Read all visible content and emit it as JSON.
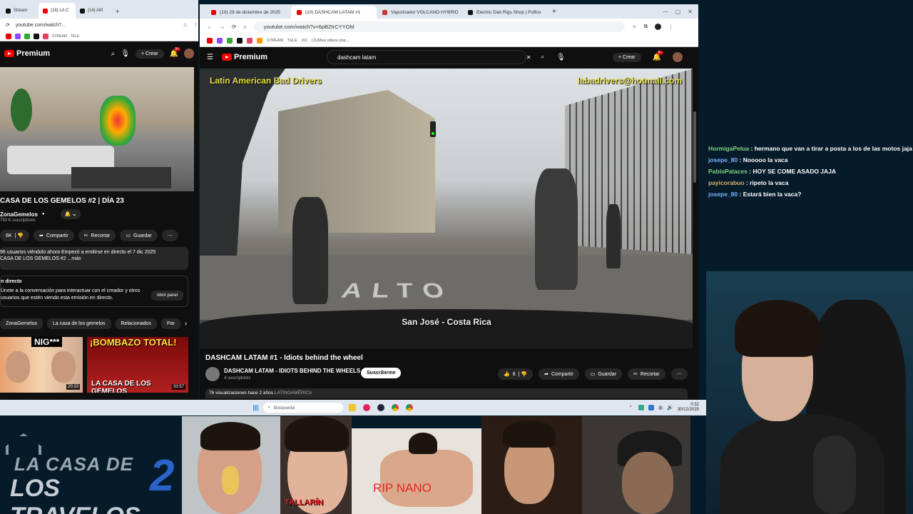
{
  "left_browser": {
    "tabs": [
      "Stream",
      "(18) LA C",
      "(14) AM"
    ],
    "url": "youtube.com/watch?...",
    "bookmarks": [
      "STREAM",
      "TELE"
    ],
    "yt_brand": "Premium",
    "create_label": "Crear",
    "notif_count": "9+",
    "video_title": "CASA DE LOS GEMELOS #2 | DÍA 23",
    "channel": "ZonaGemelos",
    "subscribers": "750 K suscriptores",
    "like_count": "6K",
    "actions": [
      "Compartir",
      "Recortar",
      "Guardar"
    ],
    "desc_line1": "96 usuarios viéndolo ahora  Empezó a emitirse en directo el 7 dic 2025",
    "desc_line2": "CASA DE LOS GEMELOS #2 ...más",
    "live_heading": "n directo",
    "live_text": "Únete a la conversación para interactuar con el creador y otros usuarios que estén viendo esta emisión en directo.",
    "open_panel": "Abrir panel",
    "chips": [
      "ZonaGemelos",
      "La casa de los gemelos",
      "Relacionados",
      "Par"
    ],
    "thumb1_text": "NIG***",
    "thumb1_time": "20:10",
    "thumb2_text": "¡BOMBAZO TOTAL!",
    "thumb2_sub": "LA CASA DE LOS GEMELOS",
    "thumb2_time": "33:57"
  },
  "right_browser": {
    "tabs": [
      "(10) 29 de diciembre de 2025",
      "(10) DASHCAM LATAM #1",
      "Vaporizador VOLCANO HYBRID",
      "Electric Dab Rigs Shop | Puffco"
    ],
    "url": "youtube.com/watch?v=6pBZtrCYYOM",
    "bookmarks": [
      "STREAM",
      "TELE",
      "VO",
      "(11)Mea videos pop..."
    ],
    "yt_brand": "Premium",
    "search_value": "dashcam latam",
    "create_label": "Crear",
    "notif_count": "9+",
    "overlay_tl": "Latin American Bad Drivers",
    "overlay_tr": "labadrivers@hotmail.com",
    "overlay_bottom": "San José - Costa Rica",
    "video_title": "DASHCAM LATAM #1 - Idiots behind the wheel",
    "channel": "DASHCAM LATAM - IDIOTS BEHIND THE WHEELS",
    "subscribers": "4 suscriptores",
    "subscribe": "Suscribirme",
    "like_count": "6",
    "actions": [
      "Compartir",
      "Guardar",
      "Recortar"
    ],
    "views": "76 visualizaciones  hace 2 años",
    "tag": "LATINOAMÉRICA"
  },
  "taskbar": {
    "search_placeholder": "Búsqueda",
    "time": "0:32",
    "date": "30/12/2025"
  },
  "chat": [
    {
      "user": "HormigaPelua",
      "msg": "hermano que van a tirar a posta a los de las motos jaja"
    },
    {
      "user": "josepe_80",
      "msg": "Nooooo la vaca"
    },
    {
      "user": "PabloPalaces",
      "msg": "HOY SE COME ASADO JAJA"
    },
    {
      "user": "payicorabuo",
      "msg": "ripeto la vaca"
    },
    {
      "user": "josepe_80",
      "msg": "Estará bien la vaca?"
    }
  ],
  "bottom": {
    "logo_line1": "LA CASA DE",
    "logo_line2": "LOS TRAVELOS",
    "logo_num": "2",
    "tallarin": "TALLARÍN",
    "rip": "RIP NANO"
  }
}
